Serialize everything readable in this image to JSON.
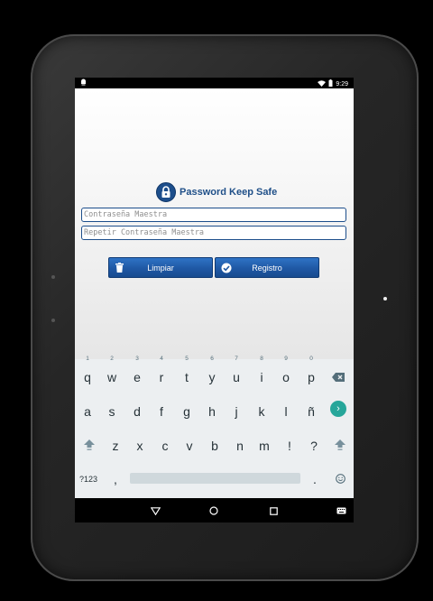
{
  "status": {
    "time": "9:29"
  },
  "app": {
    "title": "Password Keep Safe",
    "master_password_placeholder": "Contraseña Maestra",
    "repeat_password_placeholder": "Repetir Contraseña Maestra",
    "clear_label": "Limpiar",
    "register_label": "Registro"
  },
  "keyboard": {
    "row1": [
      "q",
      "w",
      "e",
      "r",
      "t",
      "y",
      "u",
      "i",
      "o",
      "p"
    ],
    "row1_hints": [
      "1",
      "2",
      "3",
      "4",
      "5",
      "6",
      "7",
      "8",
      "9",
      "0"
    ],
    "row2": [
      "a",
      "s",
      "d",
      "f",
      "g",
      "h",
      "j",
      "k",
      "l",
      "ñ"
    ],
    "row3": [
      "z",
      "x",
      "c",
      "v",
      "b",
      "n",
      "m",
      "!",
      "?"
    ],
    "symbols_label": "?123",
    "comma": ",",
    "period": "."
  },
  "colors": {
    "brand": "#1d4e8b",
    "button": "#1f58a4",
    "enter": "#26a69a"
  }
}
